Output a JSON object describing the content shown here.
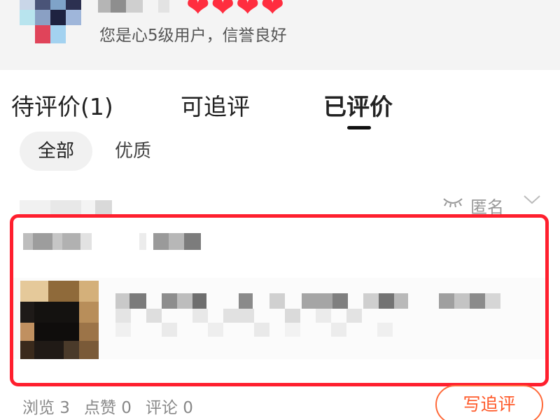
{
  "user": {
    "rating_hearts": [
      "❤",
      "❤",
      "❤",
      "❤"
    ],
    "credit_text": "您是心5级用户，信誉良好"
  },
  "tabs": [
    {
      "label": "待评价(1)"
    },
    {
      "label": "可追评"
    },
    {
      "label": "已评价"
    }
  ],
  "filters": [
    {
      "label": "全部"
    },
    {
      "label": "优质"
    }
  ],
  "review": {
    "anonymous_label": "匿名",
    "anonymous_icon": "closed-eye-icon",
    "chevron_icon": "chevron-down-icon"
  },
  "stats": {
    "views": "浏览 3",
    "likes": "点赞 0",
    "comments": "评论 0"
  },
  "follow_review_label": "写追评",
  "colors": {
    "accent_red": "#ff1f2e",
    "heart_red": "#ff2d3f",
    "follow_orange": "#ff5a2a"
  }
}
